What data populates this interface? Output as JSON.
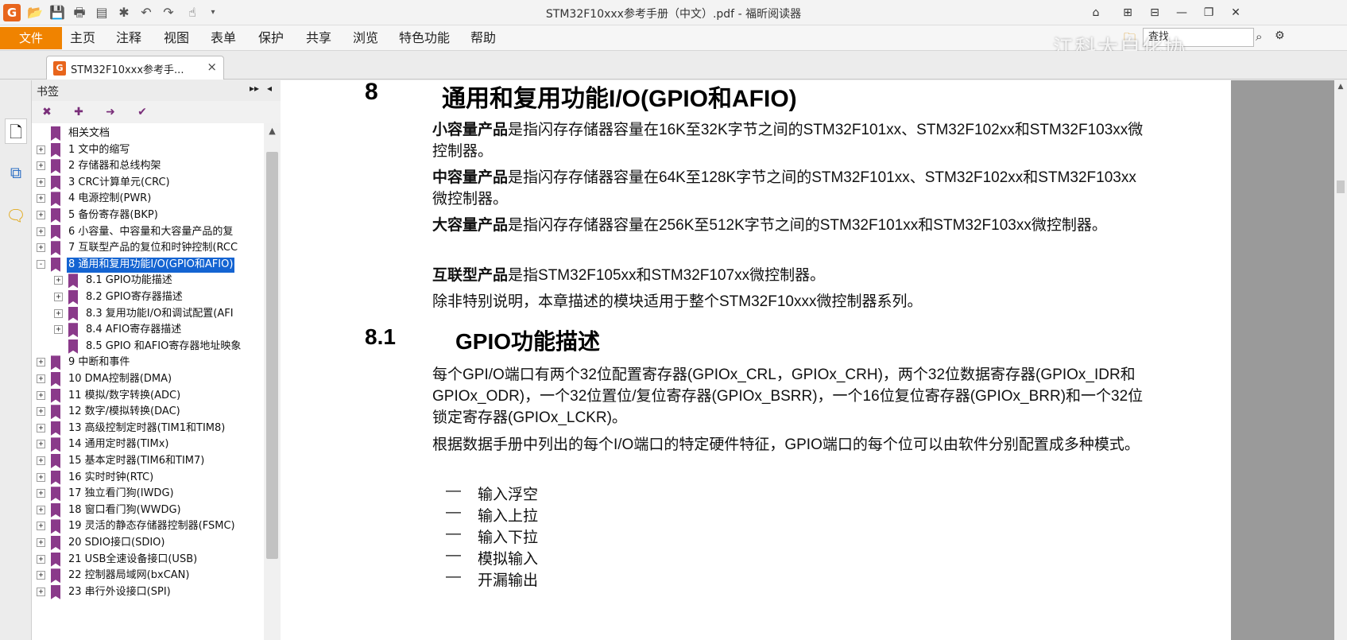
{
  "app": {
    "title": "STM32F10xxx参考手册（中文）.pdf - 福昕阅读器",
    "logo_letter": "G"
  },
  "menu": {
    "file": "文件",
    "items": [
      "主页",
      "注释",
      "视图",
      "表单",
      "保护",
      "共享",
      "浏览",
      "特色功能",
      "帮助"
    ]
  },
  "search": {
    "placeholder": "查找"
  },
  "watermark": "江科大自化协",
  "tab": {
    "label": "STM32F10xxx参考手...",
    "close": "×"
  },
  "bookmarks": {
    "title": "书签",
    "items": [
      {
        "label": "相关文档",
        "level": 0,
        "toggle": ""
      },
      {
        "label": "1 文中的缩写",
        "level": 0,
        "toggle": "+"
      },
      {
        "label": "2 存储器和总线构架",
        "level": 0,
        "toggle": "+"
      },
      {
        "label": "3 CRC计算单元(CRC)",
        "level": 0,
        "toggle": "+"
      },
      {
        "label": "4 电源控制(PWR)",
        "level": 0,
        "toggle": "+"
      },
      {
        "label": "5 备份寄存器(BKP)",
        "level": 0,
        "toggle": "+"
      },
      {
        "label": "6 小容量、中容量和大容量产品的复",
        "level": 0,
        "toggle": "+"
      },
      {
        "label": "7 互联型产品的复位和时钟控制(RCC",
        "level": 0,
        "toggle": "+"
      },
      {
        "label": "8 通用和复用功能I/O(GPIO和AFIO)",
        "level": 0,
        "toggle": "-",
        "selected": true
      },
      {
        "label": "8.1 GPIO功能描述",
        "level": 1,
        "toggle": "+"
      },
      {
        "label": "8.2 GPIO寄存器描述",
        "level": 1,
        "toggle": "+"
      },
      {
        "label": "8.3 复用功能I/O和调试配置(AFI",
        "level": 1,
        "toggle": "+"
      },
      {
        "label": "8.4 AFIO寄存器描述",
        "level": 1,
        "toggle": "+"
      },
      {
        "label": "8.5 GPIO 和AFIO寄存器地址映象",
        "level": 1,
        "toggle": ""
      },
      {
        "label": "9 中断和事件",
        "level": 0,
        "toggle": "+"
      },
      {
        "label": "10 DMA控制器(DMA)",
        "level": 0,
        "toggle": "+"
      },
      {
        "label": "11 模拟/数字转换(ADC)",
        "level": 0,
        "toggle": "+"
      },
      {
        "label": "12 数字/模拟转换(DAC)",
        "level": 0,
        "toggle": "+"
      },
      {
        "label": "13 高级控制定时器(TIM1和TIM8)",
        "level": 0,
        "toggle": "+"
      },
      {
        "label": "14 通用定时器(TIMx)",
        "level": 0,
        "toggle": "+"
      },
      {
        "label": "15 基本定时器(TIM6和TIM7)",
        "level": 0,
        "toggle": "+"
      },
      {
        "label": "16 实时时钟(RTC)",
        "level": 0,
        "toggle": "+"
      },
      {
        "label": "17 独立看门狗(IWDG)",
        "level": 0,
        "toggle": "+"
      },
      {
        "label": "18 窗口看门狗(WWDG)",
        "level": 0,
        "toggle": "+"
      },
      {
        "label": "19 灵活的静态存储器控制器(FSMC)",
        "level": 0,
        "toggle": "+"
      },
      {
        "label": "20 SDIO接口(SDIO)",
        "level": 0,
        "toggle": "+"
      },
      {
        "label": "21 USB全速设备接口(USB)",
        "level": 0,
        "toggle": "+"
      },
      {
        "label": "22 控制器局域网(bxCAN)",
        "level": 0,
        "toggle": "+"
      },
      {
        "label": "23 串行外设接口(SPI)",
        "level": 0,
        "toggle": "+"
      }
    ]
  },
  "document": {
    "h1_num": "8",
    "h1_text": "通用和复用功能I/O(GPIO和AFIO)",
    "p1_bold": "小容量产品",
    "p1_text": "是指闪存存储器容量在16K至32K字节之间的STM32F101xx、STM32F102xx和STM32F103xx微控制器。",
    "p2_bold": "中容量产品",
    "p2_text": "是指闪存存储器容量在64K至128K字节之间的STM32F101xx、STM32F102xx和STM32F103xx微控制器。",
    "p3_bold": "大容量产品",
    "p3_text": "是指闪存存储器容量在256K至512K字节之间的STM32F101xx和STM32F103xx微控制器。",
    "p4_bold": "互联型产品",
    "p4_text": "是指STM32F105xx和STM32F107xx微控制器。",
    "p5_text": "除非特别说明，本章描述的模块适用于整个STM32F10xxx微控制器系列。",
    "h2_num": "8.1",
    "h2_text": "GPIO功能描述",
    "p6_text": "每个GPI/O端口有两个32位配置寄存器(GPIOx_CRL，GPIOx_CRH)，两个32位数据寄存器(GPIOx_IDR和GPIOx_ODR)，一个32位置位/复位寄存器(GPIOx_BSRR)，一个16位复位寄存器(GPIOx_BRR)和一个32位锁定寄存器(GPIOx_LCKR)。",
    "p7_text": "根据数据手册中列出的每个I/O端口的特定硬件特征，GPIO端口的每个位可以由软件分别配置成多种模式。",
    "list_dash": "—",
    "list": [
      "输入浮空",
      "输入上拉",
      "输入下拉",
      "模拟输入",
      "开漏输出"
    ]
  }
}
